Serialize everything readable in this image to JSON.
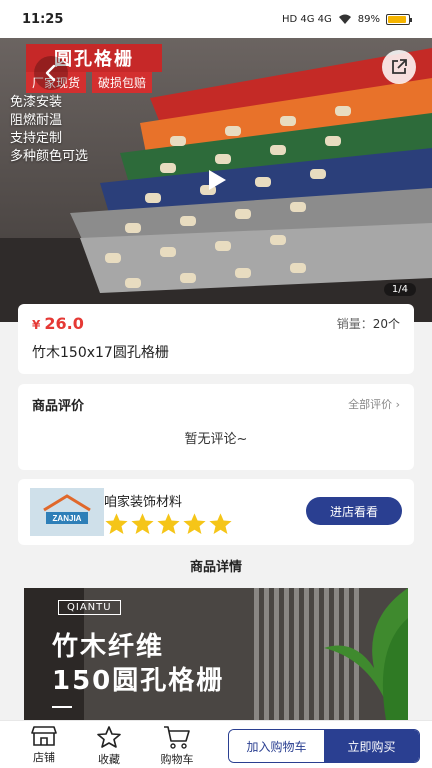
{
  "status_bar": {
    "time": "11:25",
    "network": "HD 4G 4G",
    "battery": "89%",
    "battery_level": 0.89
  },
  "hero": {
    "title": "圆孔格栅",
    "tags": [
      "厂家现货",
      "破损包赔"
    ],
    "features": [
      "免漆安装",
      "阻燃耐温",
      "支持定制",
      "多种颜色可选"
    ],
    "counter": "1/4",
    "back_icon": "back-arrow-icon",
    "share_icon": "share-icon",
    "play_icon": "play-icon"
  },
  "product": {
    "currency": "¥",
    "price": "26.0",
    "sales_label": "销量：",
    "sales_count": "20个",
    "name": "竹木150x17圆孔格栅"
  },
  "reviews": {
    "title": "商品评价",
    "all_label": "全部评价",
    "empty": "暂无评论~"
  },
  "shop": {
    "logo_text": "ZANJIA",
    "name": "咱家装饰材料",
    "rating": 5,
    "visit_label": "进店看看"
  },
  "details": {
    "heading": "商品详情",
    "brand": "QIANTU",
    "line1": "竹木纤维",
    "line2": "150圆孔格栅"
  },
  "bottom_bar": {
    "shop_label": "店铺",
    "fav_label": "收藏",
    "cart_label": "购物车",
    "add_cart_label": "加入购物车",
    "buy_label": "立即购买"
  },
  "colors": {
    "accent": "#2a3f91",
    "price": "#e53935",
    "star": "#f5c518"
  }
}
